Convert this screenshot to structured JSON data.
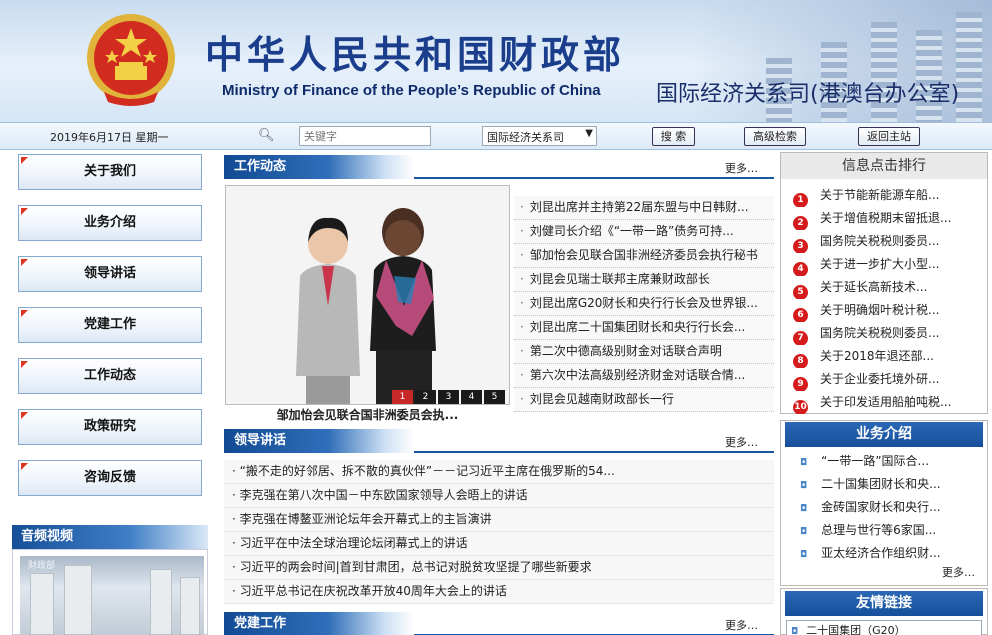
{
  "header": {
    "cn_title": "中华人民共和国财政部",
    "en_title": "Ministry of Finance of the People’s Republic of China",
    "dept_title": "国际经济关系司(港澳台办公室)"
  },
  "toolbar": {
    "date": "2019年6月17日 星期一",
    "search_placeholder": "关键字",
    "scope_selected": "国际经济关系司",
    "search_label": "搜 索",
    "advanced_label": "高级检索",
    "home_label": "返回主站"
  },
  "left_nav": [
    "关于我们",
    "业务介绍",
    "领导讲话",
    "党建工作",
    "工作动态",
    "政策研究",
    "咨询反馈"
  ],
  "audio_video": {
    "title": "音频视频",
    "watermark": "财政部"
  },
  "work_news": {
    "title": "工作动态",
    "more": "更多…",
    "caption": "邹加怡会见联合国非洲委员会执...",
    "slides": [
      "1",
      "2",
      "3",
      "4",
      "5"
    ],
    "items": [
      "刘昆出席并主持第22届东盟与中日韩财...",
      "刘健司长介绍《“一带一路”债务可持...",
      "邹加怡会见联合国非洲经济委员会执行秘书",
      "刘昆会见瑞士联邦主席兼财政部长",
      "刘昆出席G20财长和央行行长会及世界银...",
      "刘昆出席二十国集团财长和央行行长会...",
      "第二次中德高级别财金对话联合声明",
      "第六次中法高级别经济财金对话联合情...",
      "刘昆会见越南财政部长一行"
    ]
  },
  "speech": {
    "title": "领导讲话",
    "more": "更多…",
    "items": [
      "“搬不走的好邻居、拆不散的真伙伴”－－记习近平主席在俄罗斯的54...",
      "李克强在第八次中国－中东欧国家领导人会晤上的讲话",
      "李克强在博鳌亚洲论坛年会开幕式上的主旨演讲",
      "习近平在中法全球治理论坛闭幕式上的讲话",
      "习近平的两会时间|首到甘肃团，总书记对脱贫攻坚提了哪些新要求",
      "习近平总书记在庆祝改革开放40周年大会上的讲话"
    ]
  },
  "party": {
    "title": "党建工作",
    "more": "更多…"
  },
  "hot_ranking": {
    "title": "信息点击排行",
    "items": [
      {
        "n": "1",
        "t": "关于节能新能源车船..."
      },
      {
        "n": "2",
        "t": "关于增值税期末留抵退..."
      },
      {
        "n": "3",
        "t": "国务院关税税则委员..."
      },
      {
        "n": "4",
        "t": "关于进一步扩大小型..."
      },
      {
        "n": "5",
        "t": "关于延长高新技术..."
      },
      {
        "n": "6",
        "t": "关于明确烟叶税计税..."
      },
      {
        "n": "7",
        "t": "国务院关税税则委员..."
      },
      {
        "n": "8",
        "t": "关于2018年退还部..."
      },
      {
        "n": "9",
        "t": "关于企业委托境外研..."
      },
      {
        "n": "10",
        "t": "关于印发适用船舶吨税..."
      }
    ]
  },
  "business": {
    "title": "业务介绍",
    "more": "更多…",
    "items": [
      "“一带一路”国际合...",
      "二十国集团财长和央...",
      "金砖国家财长和央行...",
      "总理与世行等6家国...",
      "亚太经济合作组织财..."
    ]
  },
  "friends": {
    "title": "友情链接",
    "selected": "二十国集团（G20）"
  },
  "colors": {
    "brand_blue": "#1a57a3",
    "accent_red": "#d51b1b"
  }
}
